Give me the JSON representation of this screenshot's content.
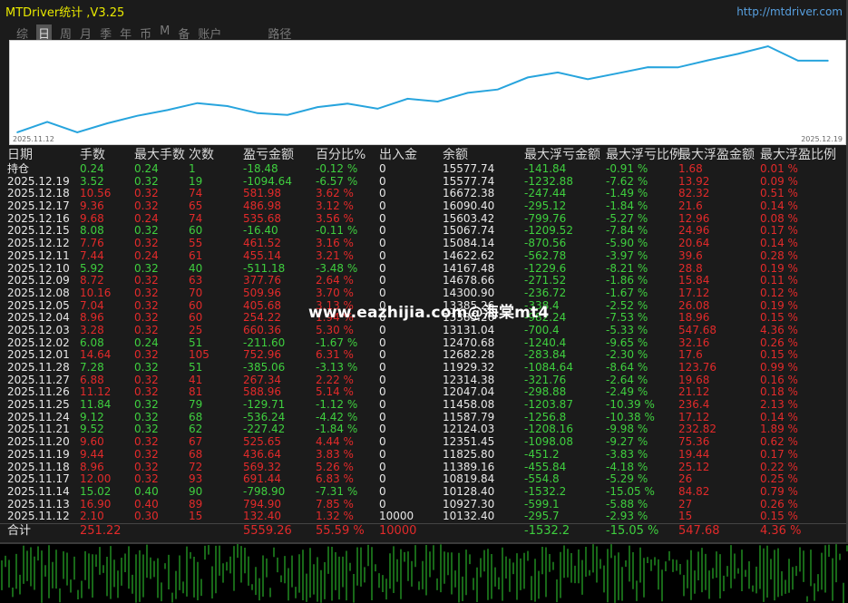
{
  "window": {
    "title": "MTDriver统计 ,V3.25",
    "url": "http://mtdriver.com"
  },
  "tabs": [
    {
      "label": "综",
      "active": false
    },
    {
      "label": "日",
      "active": true
    },
    {
      "label": "周",
      "active": false
    },
    {
      "label": "月",
      "active": false
    },
    {
      "label": "季",
      "active": false
    },
    {
      "label": "年",
      "active": false
    },
    {
      "label": "币",
      "active": false
    },
    {
      "label": "M",
      "active": false
    },
    {
      "label": "备",
      "active": false
    },
    {
      "label": "账户",
      "active": false
    }
  ],
  "path_label": "路径",
  "chart_data": {
    "type": "line",
    "x_start_label": "2025.11.12",
    "x_end_label": "2025.12.19",
    "line_color": "#27a4dd",
    "y": [
      10132.4,
      10927.3,
      10128.4,
      10819.84,
      11389.16,
      11825.8,
      12351.45,
      12124.03,
      11587.79,
      11458.08,
      12047.04,
      12314.38,
      11929.32,
      12682.28,
      12470.68,
      13131.04,
      13385.26,
      14300.9,
      14678.66,
      14167.48,
      14622.62,
      15084.16,
      15067.74,
      15603.42,
      16090.4,
      16672.38,
      15577.74,
      15577.74
    ]
  },
  "table": {
    "headers": [
      "日期",
      "手数",
      "最大手数",
      "次数",
      "盈亏金额",
      "百分比%",
      "出入金",
      "余额",
      "最大浮亏金额",
      "最大浮亏比例",
      "最大浮盈金额",
      "最大浮盈比例"
    ],
    "rows": [
      [
        "持仓",
        "0.24",
        "0.24",
        "1",
        "-18.48",
        "-0.12 %",
        "0",
        "15577.74",
        "-141.84",
        "-0.91 %",
        "1.68",
        "0.01 %"
      ],
      [
        "2025.12.19",
        "3.52",
        "0.32",
        "19",
        "-1094.64",
        "-6.57 %",
        "0",
        "15577.74",
        "-1232.88",
        "-7.62 %",
        "13.92",
        "0.09 %"
      ],
      [
        "2025.12.18",
        "10.56",
        "0.32",
        "74",
        "581.98",
        "3.62 %",
        "0",
        "16672.38",
        "-247.44",
        "-1.49 %",
        "82.32",
        "0.51 %"
      ],
      [
        "2025.12.17",
        "9.36",
        "0.32",
        "65",
        "486.98",
        "3.12 %",
        "0",
        "16090.40",
        "-295.12",
        "-1.84 %",
        "21.6",
        "0.14 %"
      ],
      [
        "2025.12.16",
        "9.68",
        "0.24",
        "74",
        "535.68",
        "3.56 %",
        "0",
        "15603.42",
        "-799.76",
        "-5.27 %",
        "12.96",
        "0.08 %"
      ],
      [
        "2025.12.15",
        "8.08",
        "0.32",
        "60",
        "-16.40",
        "-0.11 %",
        "0",
        "15067.74",
        "-1209.52",
        "-7.84 %",
        "24.96",
        "0.17 %"
      ],
      [
        "2025.12.12",
        "7.76",
        "0.32",
        "55",
        "461.52",
        "3.16 %",
        "0",
        "15084.14",
        "-870.56",
        "-5.90 %",
        "20.64",
        "0.14 %"
      ],
      [
        "2025.12.11",
        "7.44",
        "0.24",
        "61",
        "455.14",
        "3.21 %",
        "0",
        "14622.62",
        "-562.78",
        "-3.97 %",
        "39.6",
        "0.28 %"
      ],
      [
        "2025.12.10",
        "5.92",
        "0.32",
        "40",
        "-511.18",
        "-3.48 %",
        "0",
        "14167.48",
        "-1229.6",
        "-8.21 %",
        "28.8",
        "0.19 %"
      ],
      [
        "2025.12.09",
        "8.72",
        "0.32",
        "63",
        "377.76",
        "2.64 %",
        "0",
        "14678.66",
        "-271.52",
        "-1.86 %",
        "15.84",
        "0.11 %"
      ],
      [
        "2025.12.08",
        "10.16",
        "0.32",
        "70",
        "509.96",
        "3.70 %",
        "0",
        "14300.90",
        "-236.72",
        "-1.67 %",
        "17.12",
        "0.12 %"
      ],
      [
        "2025.12.05",
        "7.04",
        "0.32",
        "60",
        "405.68",
        "3.13 %",
        "0",
        "13385.26",
        "-338.4",
        "-2.52 %",
        "26.08",
        "0.19 %"
      ],
      [
        "2025.12.04",
        "8.96",
        "0.32",
        "60",
        "254.22",
        "1.94 %",
        "0",
        "13385.26",
        "-982.24",
        "-7.53 %",
        "18.96",
        "0.15 %"
      ],
      [
        "2025.12.03",
        "3.28",
        "0.32",
        "25",
        "660.36",
        "5.30 %",
        "0",
        "13131.04",
        "-700.4",
        "-5.33 %",
        "547.68",
        "4.36 %"
      ],
      [
        "2025.12.02",
        "6.08",
        "0.24",
        "51",
        "-211.60",
        "-1.67 %",
        "0",
        "12470.68",
        "-1240.4",
        "-9.65 %",
        "32.16",
        "0.26 %"
      ],
      [
        "2025.12.01",
        "14.64",
        "0.32",
        "105",
        "752.96",
        "6.31 %",
        "0",
        "12682.28",
        "-283.84",
        "-2.30 %",
        "17.6",
        "0.15 %"
      ],
      [
        "2025.11.28",
        "7.28",
        "0.32",
        "51",
        "-385.06",
        "-3.13 %",
        "0",
        "11929.32",
        "-1084.64",
        "-8.64 %",
        "123.76",
        "0.99 %"
      ],
      [
        "2025.11.27",
        "6.88",
        "0.32",
        "41",
        "267.34",
        "2.22 %",
        "0",
        "12314.38",
        "-321.76",
        "-2.64 %",
        "19.68",
        "0.16 %"
      ],
      [
        "2025.11.26",
        "11.12",
        "0.32",
        "81",
        "588.96",
        "5.14 %",
        "0",
        "12047.04",
        "-298.88",
        "-2.49 %",
        "21.12",
        "0.18 %"
      ],
      [
        "2025.11.25",
        "11.84",
        "0.32",
        "79",
        "-129.71",
        "-1.12 %",
        "0",
        "11458.08",
        "-1203.87",
        "-10.39 %",
        "236.4",
        "2.13 %"
      ],
      [
        "2025.11.24",
        "9.12",
        "0.32",
        "68",
        "-536.24",
        "-4.42 %",
        "0",
        "11587.79",
        "-1256.8",
        "-10.38 %",
        "17.12",
        "0.14 %"
      ],
      [
        "2025.11.21",
        "9.52",
        "0.32",
        "62",
        "-227.42",
        "-1.84 %",
        "0",
        "12124.03",
        "-1208.16",
        "-9.98 %",
        "232.82",
        "1.89 %"
      ],
      [
        "2025.11.20",
        "9.60",
        "0.32",
        "67",
        "525.65",
        "4.44 %",
        "0",
        "12351.45",
        "-1098.08",
        "-9.27 %",
        "75.36",
        "0.62 %"
      ],
      [
        "2025.11.19",
        "9.44",
        "0.32",
        "68",
        "436.64",
        "3.83 %",
        "0",
        "11825.80",
        "-451.2",
        "-3.83 %",
        "19.44",
        "0.17 %"
      ],
      [
        "2025.11.18",
        "8.96",
        "0.32",
        "72",
        "569.32",
        "5.26 %",
        "0",
        "11389.16",
        "-455.84",
        "-4.18 %",
        "25.12",
        "0.22 %"
      ],
      [
        "2025.11.17",
        "12.00",
        "0.32",
        "93",
        "691.44",
        "6.83 %",
        "0",
        "10819.84",
        "-554.8",
        "-5.29 %",
        "26",
        "0.25 %"
      ],
      [
        "2025.11.14",
        "15.02",
        "0.40",
        "90",
        "-798.90",
        "-7.31 %",
        "0",
        "10128.40",
        "-1532.2",
        "-15.05 %",
        "84.82",
        "0.79 %"
      ],
      [
        "2025.11.13",
        "16.90",
        "0.40",
        "89",
        "794.90",
        "7.85 %",
        "0",
        "10927.30",
        "-599.1",
        "-5.88 %",
        "27",
        "0.26 %"
      ],
      [
        "2025.11.12",
        "2.10",
        "0.30",
        "15",
        "132.40",
        "1.32 %",
        "10000",
        "10132.40",
        "-295.7",
        "-2.93 %",
        "15",
        "0.15 %"
      ]
    ],
    "total": [
      "合计",
      "251.22",
      "",
      "",
      "5559.26",
      "55.59 %",
      "10000",
      "",
      "-1532.2",
      "-15.05 %",
      "547.68",
      "4.36 %"
    ]
  },
  "watermark": "www.eazhijia.com@海棠mt4",
  "colors": {
    "profit": "#e22a2a",
    "loss": "#3fcf3f",
    "title": "#e8e800",
    "background": "#1b1b1b"
  }
}
